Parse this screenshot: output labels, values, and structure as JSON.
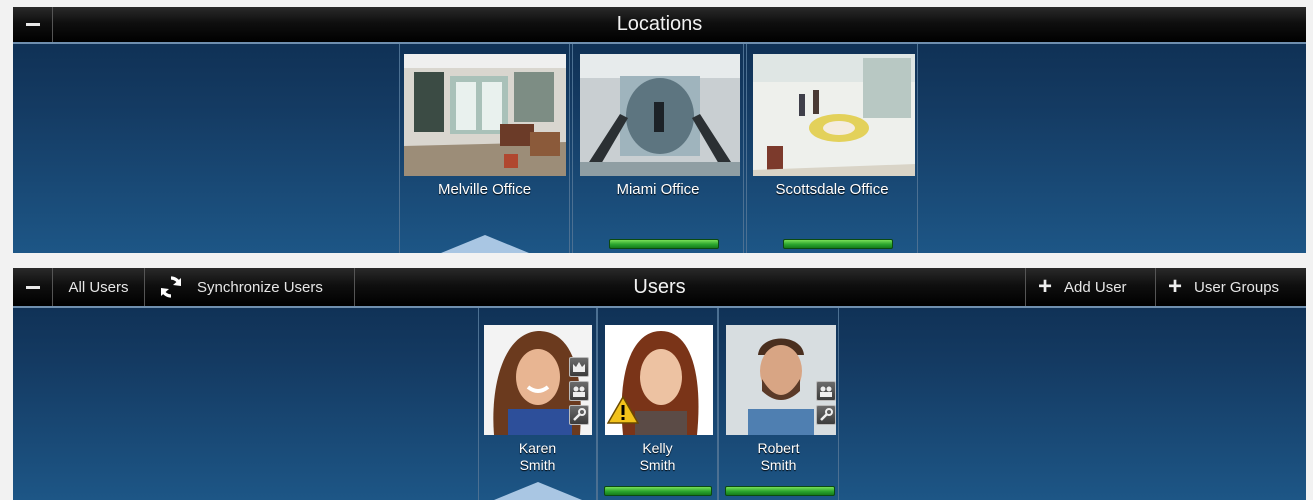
{
  "locations": {
    "title": "Locations",
    "items": [
      {
        "name": "Melville Office",
        "state": "selected"
      },
      {
        "name": "Miami Office",
        "state": "online"
      },
      {
        "name": "Scottsdale Office",
        "state": "online"
      }
    ]
  },
  "users": {
    "title": "Users",
    "toolbar": {
      "all_users_label": "All Users",
      "sync_label": "Synchronize Users",
      "add_user_label": "Add User",
      "user_groups_label": "User Groups"
    },
    "items": [
      {
        "first": "Karen",
        "last": "Smith",
        "state": "selected",
        "roles": [
          "admin-crown-icon",
          "group-icon",
          "wrench-icon"
        ]
      },
      {
        "first": "Kelly",
        "last": "Smith",
        "state": "online",
        "warning": true,
        "roles": []
      },
      {
        "first": "Robert",
        "last": "Smith",
        "state": "online",
        "roles": [
          "group-icon",
          "wrench-icon"
        ]
      }
    ]
  },
  "colors": {
    "panel_top": "#0d2c4e",
    "panel_bottom": "#1d5686",
    "status_green": "#2aa52e",
    "selection_arrow": "#a9c6e3",
    "warning_yellow": "#f2c21b"
  }
}
